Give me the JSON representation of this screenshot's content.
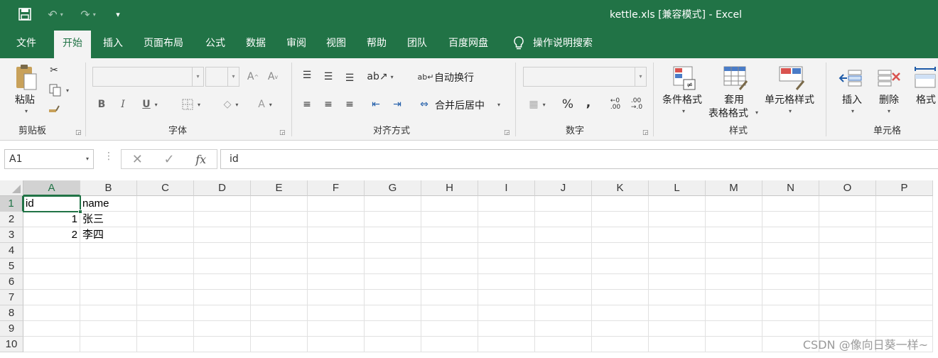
{
  "window": {
    "title": "kettle.xls  [兼容模式]  -  Excel"
  },
  "tabs": [
    "文件",
    "开始",
    "插入",
    "页面布局",
    "公式",
    "数据",
    "审阅",
    "视图",
    "帮助",
    "团队",
    "百度网盘"
  ],
  "active_tab": "开始",
  "tell_me": "操作说明搜索",
  "ribbon": {
    "clipboard": {
      "paste": "粘贴",
      "label": "剪贴板"
    },
    "font": {
      "label": "字体",
      "bold": "B",
      "italic": "I",
      "underline": "U",
      "grow": "A",
      "shrink": "A",
      "color": "A"
    },
    "alignment": {
      "wrap": "自动换行",
      "merge": "合并后居中",
      "label": "对齐方式"
    },
    "number": {
      "percent": "%",
      "comma": ",",
      "label": "数字"
    },
    "styles": {
      "conditional": "条件格式",
      "table_line1": "套用",
      "table_line2": "表格格式",
      "cell_styles": "单元格样式",
      "label": "样式"
    },
    "cells": {
      "insert": "插入",
      "delete": "删除",
      "format": "格式",
      "label": "单元格"
    }
  },
  "formula_bar": {
    "name_box": "A1",
    "value": "id",
    "fx": "fx"
  },
  "columns": [
    "A",
    "B",
    "C",
    "D",
    "E",
    "F",
    "G",
    "H",
    "I",
    "J",
    "K",
    "L",
    "M",
    "N",
    "O",
    "P"
  ],
  "rows": [
    "1",
    "2",
    "3",
    "4",
    "5",
    "6",
    "7",
    "8",
    "9",
    "10"
  ],
  "cells": {
    "A1": "id",
    "B1": "name",
    "A2": "1",
    "B2": "张三",
    "A3": "2",
    "B3": "李四"
  },
  "selected_cell": "A1",
  "watermark": "CSDN @像向日葵一样~",
  "colors": {
    "accent": "#217346",
    "ribbon_bg": "#f3f3f3"
  }
}
